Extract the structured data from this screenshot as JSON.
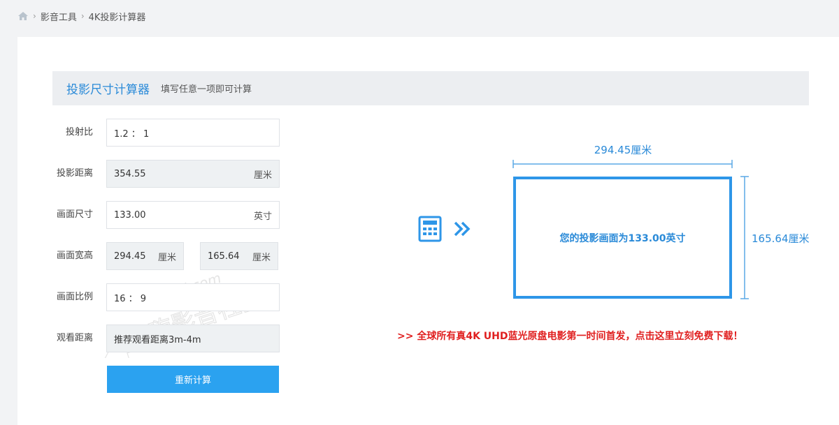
{
  "breadcrumb": {
    "items": [
      "影音工具",
      "4K投影计算器"
    ]
  },
  "header": {
    "title": "投影尺寸计算器",
    "subtitle": "填写任意一项即可计算"
  },
  "form": {
    "throw_ratio": {
      "label": "投射比",
      "value": "1.2 ： 1"
    },
    "distance": {
      "label": "投影距离",
      "value": "354.55",
      "unit": "厘米"
    },
    "screen_size": {
      "label": "画面尺寸",
      "value": "133.00",
      "unit": "英寸"
    },
    "dimensions": {
      "label": "画面宽高",
      "width": "294.45",
      "width_unit": "厘米",
      "times": "×",
      "height": "165.64",
      "height_unit": "厘米"
    },
    "aspect": {
      "label": "画面比例",
      "value": "16 ： 9"
    },
    "viewing": {
      "label": "观看距离",
      "value": "推荐观看距离3m-4m"
    },
    "recalc_label": "重新计算"
  },
  "diagram": {
    "width_label": "294.45厘米",
    "height_label": "165.64厘米",
    "screen_text": "您的投影画面为133.00英寸"
  },
  "promo": {
    "text": ">> 全球所有真4K UHD蓝光原盘电影第一时间首发，点击这里立刻免费下载！"
  },
  "watermark": {
    "site": "zhaihai.com",
    "name": "宅嗨影音社区"
  },
  "colors": {
    "accent": "#2a8ad8",
    "button": "#2ba2f0",
    "promo": "#e02020",
    "field_gray": "#eef1f3"
  },
  "icons": [
    "home-icon",
    "calculator-icon",
    "double-chevron-right-icon"
  ]
}
